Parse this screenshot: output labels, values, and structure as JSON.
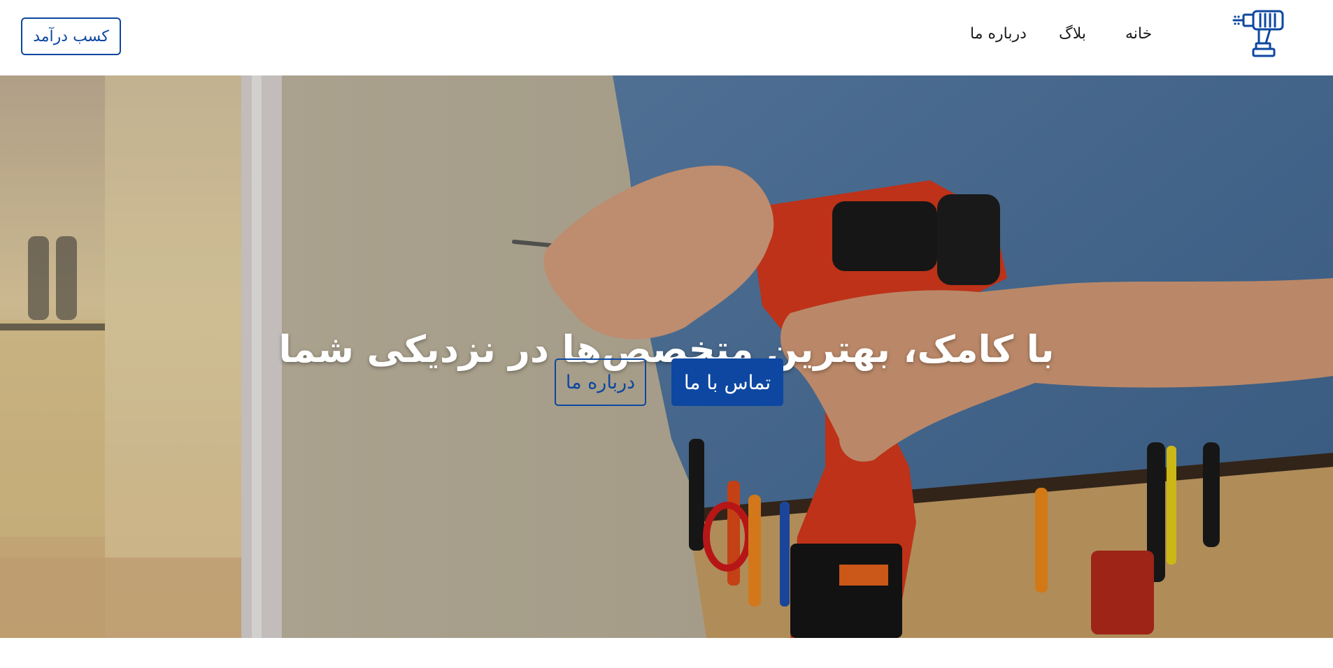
{
  "header": {
    "logo_icon": "drill-icon",
    "earn_button": "کسب درآمد",
    "nav": [
      "خانه",
      "بلاگ",
      "درباره ما"
    ]
  },
  "hero": {
    "title": "با کامک، بهترین متخصص‌ها در نزدیکی شما",
    "primary_button": "تماس با ما",
    "secondary_button": "درباره ما"
  },
  "colors": {
    "brand": "#0d47a1",
    "nav_text": "#1a1a1a",
    "hero_text": "#ffffff"
  }
}
